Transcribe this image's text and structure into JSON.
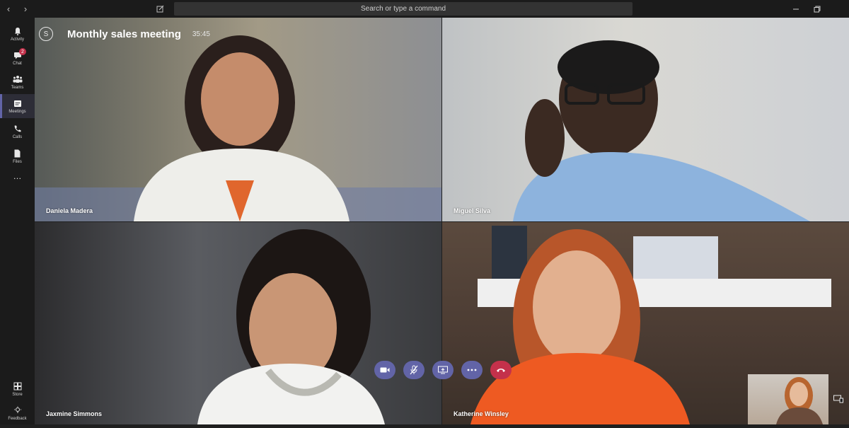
{
  "titlebar": {
    "back_glyph": "‹",
    "forward_glyph": "›",
    "search_placeholder": "Search or type a command",
    "icons": [
      "back-icon",
      "forward-icon",
      "compose-icon",
      "minimize-icon",
      "restore-icon"
    ]
  },
  "rail": {
    "items": [
      {
        "label": "Activity",
        "icon": "bell-icon"
      },
      {
        "label": "Chat",
        "icon": "chat-icon",
        "badge": "2"
      },
      {
        "label": "Teams",
        "icon": "teams-icon"
      },
      {
        "label": "Meetings",
        "icon": "calendar-icon",
        "active": true
      },
      {
        "label": "Calls",
        "icon": "phone-icon"
      },
      {
        "label": "Files",
        "icon": "file-icon"
      },
      {
        "label": "…",
        "icon": "more-icon"
      }
    ],
    "bottom": [
      {
        "label": "Store",
        "icon": "store-icon"
      },
      {
        "label": "Feedback",
        "icon": "feedback-icon"
      }
    ]
  },
  "meeting": {
    "title": "Monthly sales meeting",
    "elapsed": "35:45"
  },
  "participants": [
    {
      "name": "Daniela Madera"
    },
    {
      "name": "Miguel Silva"
    },
    {
      "name": "Jaxmine Simmons"
    },
    {
      "name": "Katherine Winsley"
    }
  ],
  "controls": [
    "camera-icon",
    "mute-mic-icon",
    "share-screen-icon",
    "more-options-icon",
    "hang-up-icon"
  ],
  "colors": {
    "accent": "#6264a7",
    "hangup": "#c4314b",
    "rail": "#1b1b1b"
  }
}
